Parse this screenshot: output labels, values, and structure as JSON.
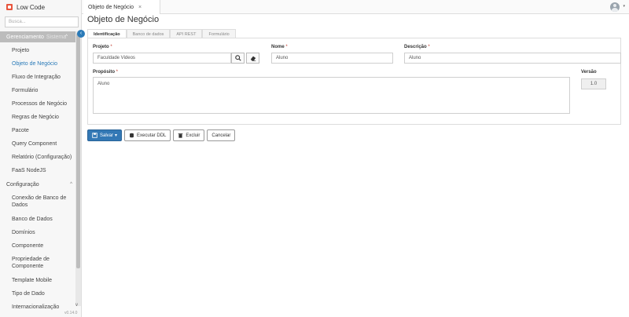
{
  "app": {
    "title": "Low Code",
    "version": "v0.14.0"
  },
  "sidebar": {
    "search_placeholder": "Busca...",
    "groups": [
      {
        "label": "Gerenciamento",
        "suffix": "Sistema"
      },
      {
        "label": "Configuração"
      }
    ],
    "gerenciamento_items": [
      "Projeto",
      "Objeto de Negócio",
      "Fluxo de Integração",
      "Formulário",
      "Processos de Negócio",
      "Regras de Negócio",
      "Pacote",
      "Query Component",
      "Relatório (Configuração)",
      "FaaS NodeJS"
    ],
    "configuracao_items": [
      "Conexão de Banco de Dados",
      "Banco de Dados",
      "Domínios",
      "Componente",
      "Propriedade de Componente",
      "Template Mobile",
      "Tipo de Dado",
      "Internacionalização"
    ]
  },
  "topbar": {
    "open_tab": "Objeto de Negócio",
    "close_glyph": "×"
  },
  "main": {
    "title": "Objeto de Negócio",
    "tabs": [
      "Identificação",
      "Banco de dados",
      "API REST",
      "Formulário"
    ],
    "form": {
      "projeto": {
        "label": "Projeto",
        "value": "Faculdade Videos"
      },
      "nome": {
        "label": "Nome",
        "value": "Aluno"
      },
      "descricao": {
        "label": "Descrição",
        "value": "Aluno"
      },
      "proposito": {
        "label": "Propósito",
        "value": "Aluno"
      },
      "versao": {
        "label": "Versão",
        "value": "1.0"
      },
      "required_mark": "*"
    },
    "actions": {
      "salvar": "Salvar",
      "executar_ddl": "Executar DDL",
      "excluir": "Excluir",
      "cancelar": "Cancelar"
    }
  },
  "colors": {
    "accent": "#3378b5",
    "link": "#2a7ab8",
    "brand": "#e8553d"
  }
}
